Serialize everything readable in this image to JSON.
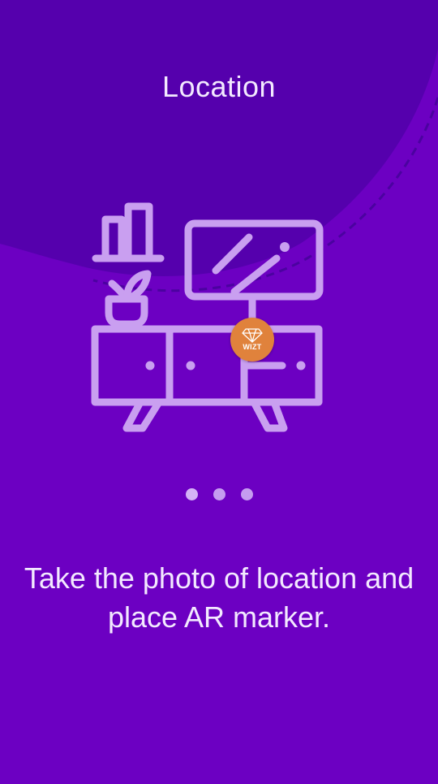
{
  "screen": {
    "title": "Location",
    "description": "Take the photo of location and place AR marker.",
    "marker_logo_text": "WIZT",
    "icon": "furniture-tv-stand-icon",
    "pagination": {
      "total": 3,
      "active_index": 0
    }
  },
  "colors": {
    "background": "#6c00c2",
    "background_blob": "#5500ad",
    "illustration": "#c99ff0",
    "marker": "#e0823c",
    "text": "#f3e9ff"
  }
}
